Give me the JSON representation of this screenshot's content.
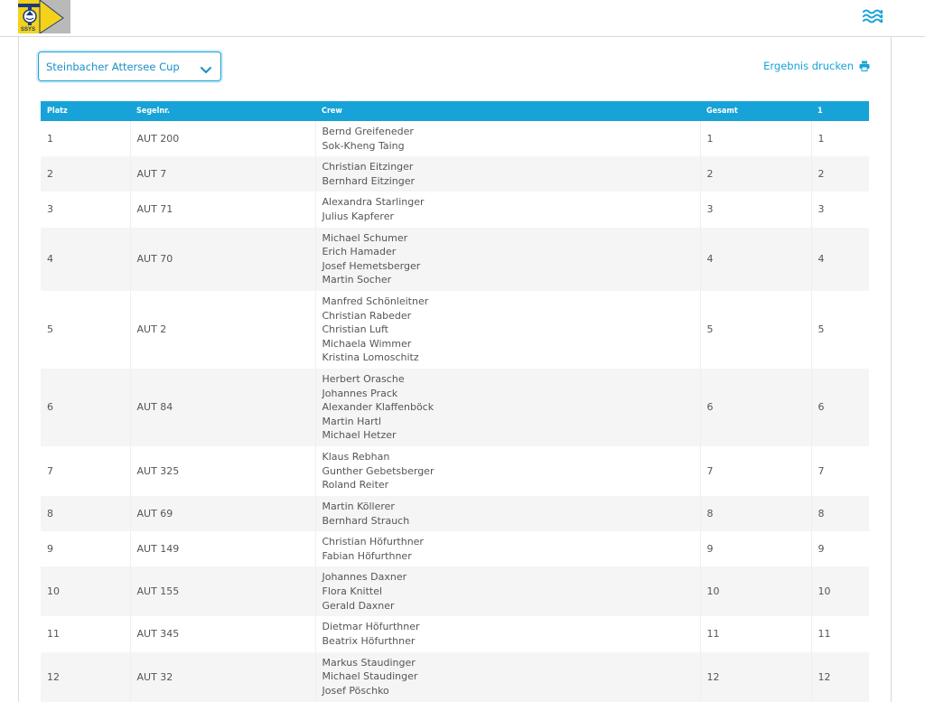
{
  "header": {
    "logo_text": "SSYS",
    "accent_color": "#17a3d8"
  },
  "controls": {
    "regatta_select_value": "Steinbacher Attersee Cup",
    "print_label": "Ergebnis drucken"
  },
  "table": {
    "columns": [
      "Platz",
      "Segelnr.",
      "Crew",
      "Gesamt",
      "1"
    ],
    "rows": [
      {
        "platz": "1",
        "segelnr": "AUT 200",
        "crew": [
          "Bernd Greifeneder",
          "Sok-Kheng Taing"
        ],
        "gesamt": "1",
        "r1": "1"
      },
      {
        "platz": "2",
        "segelnr": "AUT 7",
        "crew": [
          "Christian Eitzinger",
          "Bernhard Eitzinger"
        ],
        "gesamt": "2",
        "r1": "2"
      },
      {
        "platz": "3",
        "segelnr": "AUT 71",
        "crew": [
          "Alexandra Starlinger",
          "Julius Kapferer"
        ],
        "gesamt": "3",
        "r1": "3"
      },
      {
        "platz": "4",
        "segelnr": "AUT 70",
        "crew": [
          "Michael Schumer",
          "Erich Hamader",
          "Josef Hemetsberger",
          "Martin Socher"
        ],
        "gesamt": "4",
        "r1": "4"
      },
      {
        "platz": "5",
        "segelnr": "AUT 2",
        "crew": [
          "Manfred Schönleitner",
          "Christian Rabeder",
          "Christian Luft",
          "Michaela Wimmer",
          "Kristina Lomoschitz"
        ],
        "gesamt": "5",
        "r1": "5"
      },
      {
        "platz": "6",
        "segelnr": "AUT 84",
        "crew": [
          "Herbert Orasche",
          "Johannes Prack",
          "Alexander Klaffenböck",
          "Martin Hartl",
          "Michael Hetzer"
        ],
        "gesamt": "6",
        "r1": "6"
      },
      {
        "platz": "7",
        "segelnr": "AUT 325",
        "crew": [
          "Klaus Rebhan",
          "Gunther Gebetsberger",
          "Roland Reiter"
        ],
        "gesamt": "7",
        "r1": "7"
      },
      {
        "platz": "8",
        "segelnr": "AUT 69",
        "crew": [
          "Martin Köllerer",
          "Bernhard Strauch"
        ],
        "gesamt": "8",
        "r1": "8"
      },
      {
        "platz": "9",
        "segelnr": "AUT 149",
        "crew": [
          "Christian Höfurthner",
          "Fabian Höfurthner"
        ],
        "gesamt": "9",
        "r1": "9"
      },
      {
        "platz": "10",
        "segelnr": "AUT 155",
        "crew": [
          "Johannes Daxner",
          "Flora Knittel",
          "Gerald Daxner"
        ],
        "gesamt": "10",
        "r1": "10"
      },
      {
        "platz": "11",
        "segelnr": "AUT 345",
        "crew": [
          "Dietmar Höfurthner",
          "Beatrix  Höfurthner"
        ],
        "gesamt": "11",
        "r1": "11"
      },
      {
        "platz": "12",
        "segelnr": "AUT 32",
        "crew": [
          "Markus Staudinger",
          "Michael Staudinger",
          "Josef Pöschko"
        ],
        "gesamt": "12",
        "r1": "12"
      }
    ]
  }
}
